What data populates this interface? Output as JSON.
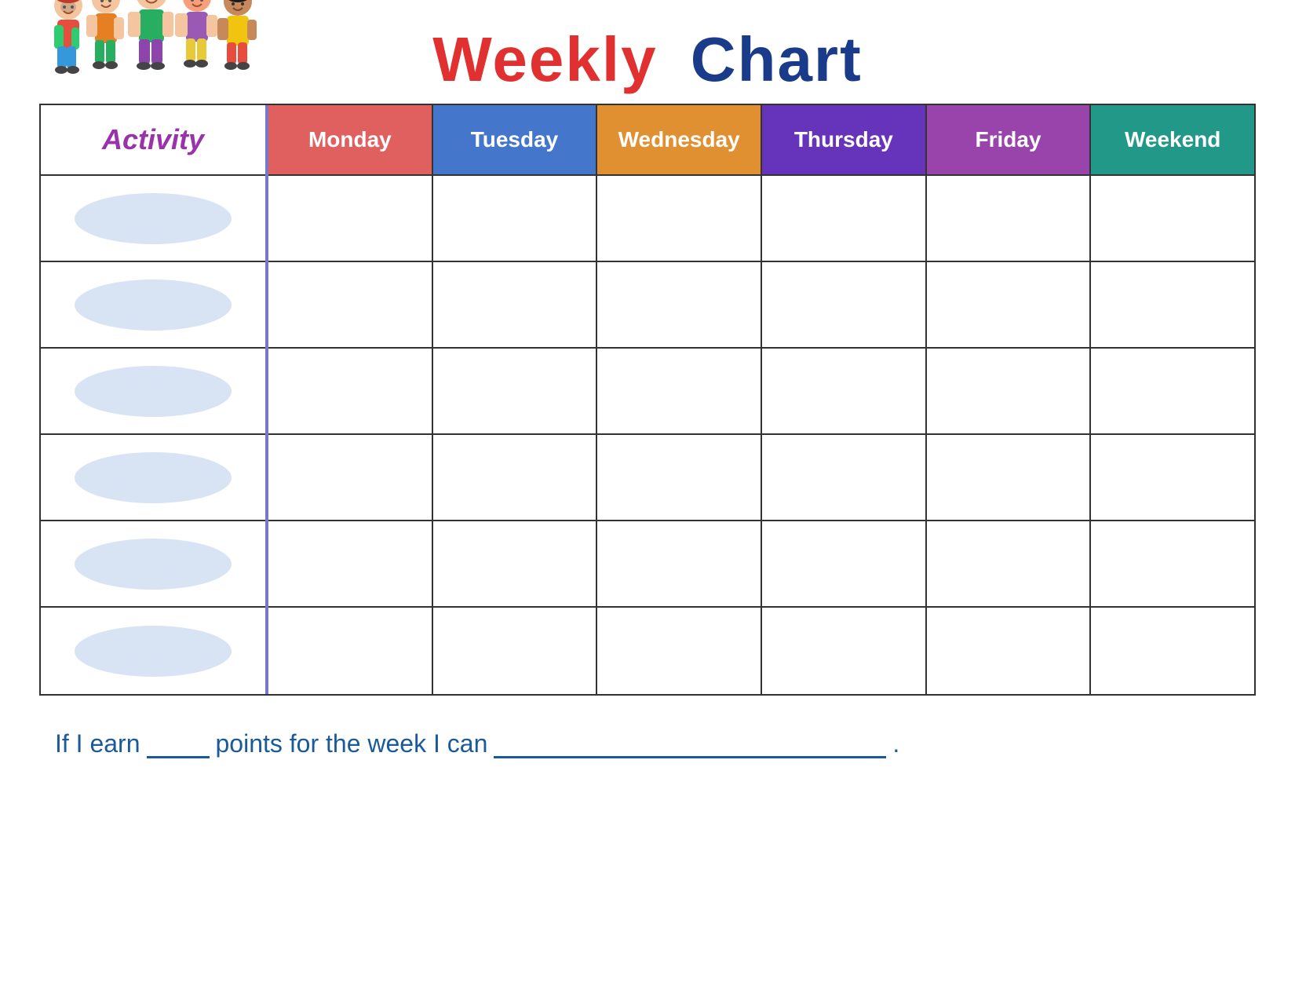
{
  "title": {
    "weekly": "Weekly",
    "chart": "Chart"
  },
  "activity": {
    "label": "Activity",
    "rows": 6
  },
  "days": [
    {
      "label": "Monday",
      "class": "day-monday"
    },
    {
      "label": "Tuesday",
      "class": "day-tuesday"
    },
    {
      "label": "Wednesday",
      "class": "day-wednesday"
    },
    {
      "label": "Thursday",
      "class": "day-thursday"
    },
    {
      "label": "Friday",
      "class": "day-friday"
    },
    {
      "label": "Weekend",
      "class": "day-weekend"
    }
  ],
  "footer": {
    "part1": "If I earn",
    "part2": "points for the week I can",
    "period": "."
  }
}
